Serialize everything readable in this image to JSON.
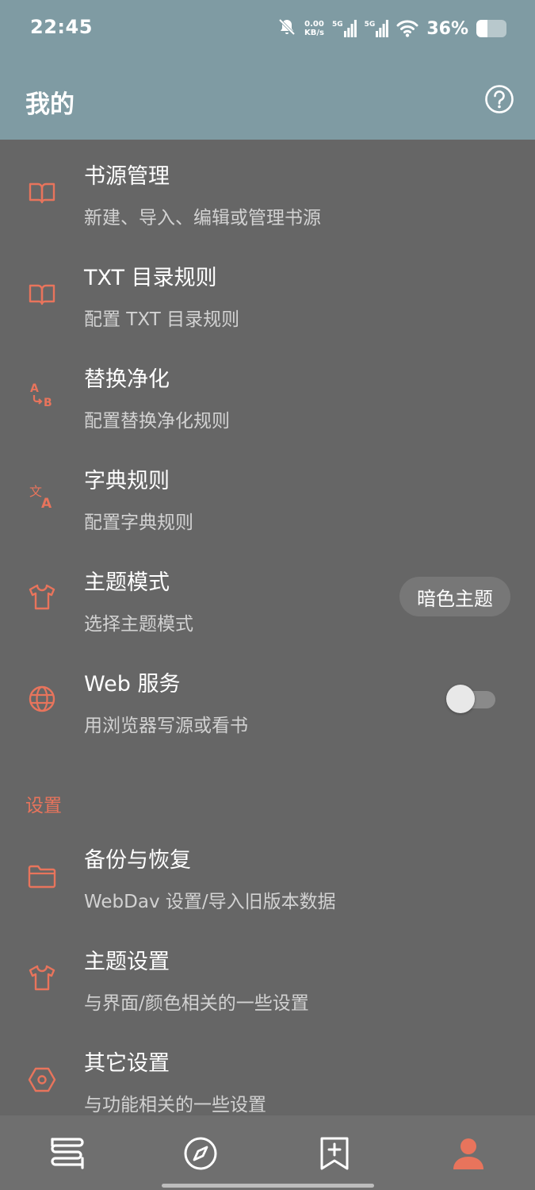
{
  "status_bar": {
    "time": "22:45",
    "net_speed_value": "0.00",
    "net_speed_unit": "KB/s",
    "signal_1": "5G",
    "signal_2": "5G",
    "battery": "36%",
    "battery_level": 0.36
  },
  "header": {
    "title": "我的"
  },
  "items": [
    {
      "title": "书源管理",
      "subtitle": "新建、导入、编辑或管理书源",
      "icon": "book-icon"
    },
    {
      "title": "TXT 目录规则",
      "subtitle": "配置 TXT 目录规则",
      "icon": "book-icon"
    },
    {
      "title": "替换净化",
      "subtitle": "配置替换净化规则",
      "icon": "replace-icon"
    },
    {
      "title": "字典规则",
      "subtitle": "配置字典规则",
      "icon": "translate-icon"
    },
    {
      "title": "主题模式",
      "subtitle": "选择主题模式",
      "icon": "shirt-icon",
      "value": "暗色主题"
    },
    {
      "title": "Web 服务",
      "subtitle": "用浏览器写源或看书",
      "icon": "globe-icon",
      "toggle": false
    }
  ],
  "settings_section": {
    "label": "设置",
    "items": [
      {
        "title": "备份与恢复",
        "subtitle": "WebDav 设置/导入旧版本数据",
        "icon": "folder-icon"
      },
      {
        "title": "主题设置",
        "subtitle": "与界面/颜色相关的一些设置",
        "icon": "shirt-icon"
      },
      {
        "title": "其它设置",
        "subtitle": "与功能相关的一些设置",
        "icon": "hexagon-icon"
      }
    ]
  },
  "bottom_nav": {
    "tabs": [
      "bookshelf-icon",
      "compass-icon",
      "bookmark-add-icon",
      "person-icon"
    ],
    "active_index": 3
  },
  "colors": {
    "accent": "#e8745c",
    "header_bg": "#7f9ba3",
    "page_bg": "#666666"
  }
}
